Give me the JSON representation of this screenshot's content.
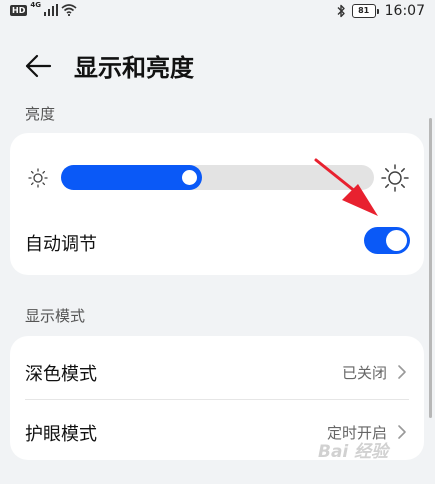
{
  "status_bar": {
    "hd_badge": "HD",
    "network_badge": "4G",
    "battery_level": "81",
    "time": "16:07",
    "icons": [
      "signal-icon",
      "wifi-icon",
      "bluetooth-icon",
      "battery-icon"
    ]
  },
  "header": {
    "back_icon": "arrow-left-icon",
    "title": "显示和亮度"
  },
  "brightness_section": {
    "title": "亮度",
    "slider_level": 0.45,
    "icons": [
      "sun-small-icon",
      "sun-large-icon"
    ],
    "auto_adjust": {
      "label": "自动调节",
      "enabled": true
    }
  },
  "display_mode_section": {
    "title": "显示模式",
    "items": [
      {
        "label": "深色模式",
        "value": "已关闭"
      },
      {
        "label": "护眼模式",
        "value": "定时开启"
      }
    ]
  },
  "annotation": {
    "color": "#e8212f"
  },
  "colors": {
    "accent": "#0a59f7",
    "background": "#f1f3f5",
    "card": "#ffffff"
  },
  "watermark_text": "Bai 经验"
}
